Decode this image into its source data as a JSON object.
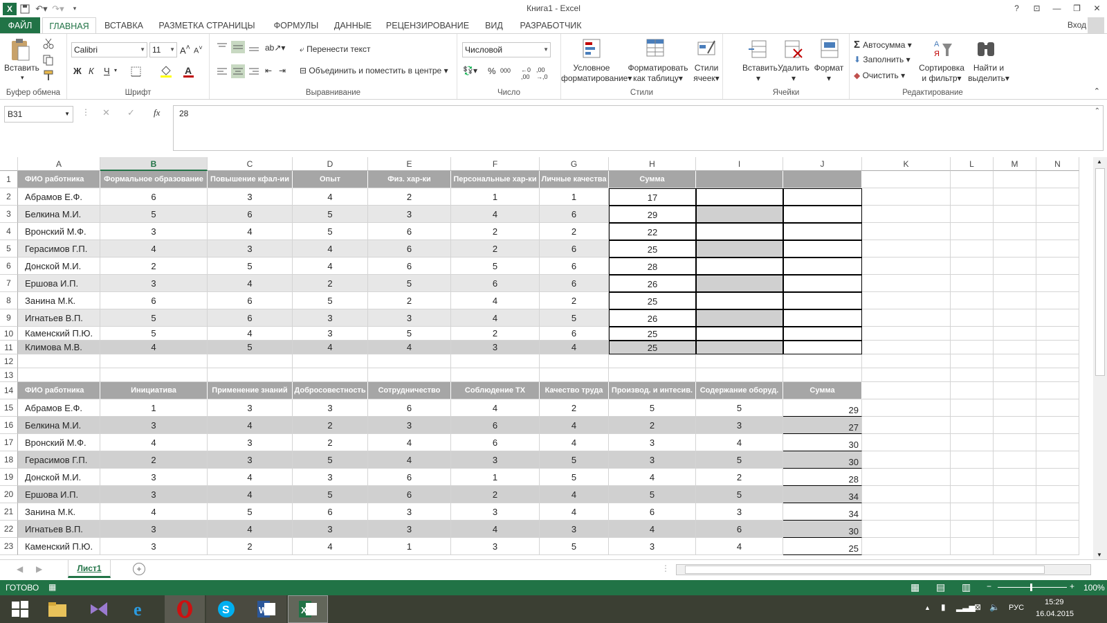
{
  "app": {
    "title": "Книга1 - Excel",
    "file_tab": "ФАЙЛ",
    "tabs": [
      "ГЛАВНАЯ",
      "ВСТАВКА",
      "РАЗМЕТКА СТРАНИЦЫ",
      "ФОРМУЛЫ",
      "ДАННЫЕ",
      "РЕЦЕНЗИРОВАНИЕ",
      "ВИД",
      "РАЗРАБОТЧИК"
    ],
    "login": "Вход",
    "help": "?"
  },
  "ribbon": {
    "clipboard": {
      "paste": "Вставить",
      "label": "Буфер обмена"
    },
    "font": {
      "name": "Calibri",
      "size": "11",
      "bold": "Ж",
      "italic": "К",
      "underline": "Ч",
      "label": "Шрифт"
    },
    "alignment": {
      "wrap": "Перенести текст",
      "merge": "Объединить и поместить в центре",
      "label": "Выравнивание"
    },
    "number": {
      "format": "Числовой",
      "label": "Число"
    },
    "styles": {
      "conditional1": "Условное",
      "conditional2": "форматирование",
      "astable1": "Форматировать",
      "astable2": "как таблицу",
      "cellstyles1": "Стили",
      "cellstyles2": "ячеек",
      "label": "Стили"
    },
    "cells": {
      "insert": "Вставить",
      "delete": "Удалить",
      "format": "Формат",
      "label": "Ячейки"
    },
    "editing": {
      "autosum": "Автосумма",
      "fill": "Заполнить",
      "clear": "Очистить",
      "sort1": "Сортировка",
      "sort2": "и фильтр",
      "find1": "Найти и",
      "find2": "выделить",
      "label": "Редактирование"
    }
  },
  "formula_bar": {
    "name_box": "B31",
    "fx": "fx",
    "value": "28"
  },
  "columns": [
    "A",
    "B",
    "C",
    "D",
    "E",
    "F",
    "G",
    "H",
    "I",
    "J",
    "K",
    "L",
    "M",
    "N"
  ],
  "selected_column": "B",
  "rows": [
    "1",
    "2",
    "3",
    "4",
    "5",
    "6",
    "7",
    "8",
    "9",
    "10",
    "11",
    "12",
    "13",
    "14",
    "15",
    "16",
    "17",
    "18",
    "19",
    "20",
    "21",
    "22",
    "23"
  ],
  "table1": {
    "headers": [
      "ФИО работника",
      "Формальное образование",
      "Повышение кфал-ии",
      "Опыт",
      "Физ. хар-ки",
      "Персональные хар-ки",
      "Личные качества",
      "Сумма"
    ],
    "rows": [
      [
        "Абрамов Е.Ф.",
        "6",
        "3",
        "4",
        "2",
        "1",
        "1",
        "17"
      ],
      [
        "Белкина М.И.",
        "5",
        "6",
        "5",
        "3",
        "4",
        "6",
        "29"
      ],
      [
        "Вронский М.Ф.",
        "3",
        "4",
        "5",
        "6",
        "2",
        "2",
        "22"
      ],
      [
        "Герасимов Г.П.",
        "4",
        "3",
        "4",
        "6",
        "2",
        "6",
        "25"
      ],
      [
        "Донской М.И.",
        "2",
        "5",
        "4",
        "6",
        "5",
        "6",
        "28"
      ],
      [
        "Ершова И.П.",
        "3",
        "4",
        "2",
        "5",
        "6",
        "6",
        "26"
      ],
      [
        "Занина М.К.",
        "6",
        "6",
        "5",
        "2",
        "4",
        "2",
        "25"
      ],
      [
        "Игнатьев В.П.",
        "5",
        "6",
        "3",
        "3",
        "4",
        "5",
        "26"
      ],
      [
        "Каменский П.Ю.",
        "5",
        "4",
        "3",
        "5",
        "2",
        "6",
        "25"
      ],
      [
        "Климова М.В.",
        "4",
        "5",
        "4",
        "4",
        "3",
        "4",
        "25"
      ]
    ]
  },
  "table2": {
    "headers": [
      "ФИО работника",
      "Инициатива",
      "Применение знаний",
      "Добросовестность",
      "Сотрудничество",
      "Соблюдение ТХ",
      "Качество труда",
      "Производ. и интесив.",
      "Содержание оборуд.",
      "Сумма"
    ],
    "rows": [
      [
        "Абрамов Е.Ф.",
        "1",
        "3",
        "3",
        "6",
        "4",
        "2",
        "5",
        "5",
        "29"
      ],
      [
        "Белкина М.И.",
        "3",
        "4",
        "2",
        "3",
        "6",
        "4",
        "2",
        "3",
        "27"
      ],
      [
        "Вронский М.Ф.",
        "4",
        "3",
        "2",
        "4",
        "6",
        "4",
        "3",
        "4",
        "30"
      ],
      [
        "Герасимов Г.П.",
        "2",
        "3",
        "5",
        "4",
        "3",
        "5",
        "3",
        "5",
        "30"
      ],
      [
        "Донской М.И.",
        "3",
        "4",
        "3",
        "6",
        "1",
        "5",
        "4",
        "2",
        "28"
      ],
      [
        "Ершова И.П.",
        "3",
        "4",
        "5",
        "6",
        "2",
        "4",
        "5",
        "5",
        "34"
      ],
      [
        "Занина М.К.",
        "4",
        "5",
        "6",
        "3",
        "3",
        "4",
        "6",
        "3",
        "34"
      ],
      [
        "Игнатьев В.П.",
        "3",
        "4",
        "3",
        "3",
        "4",
        "3",
        "4",
        "6",
        "30"
      ],
      [
        "Каменский П.Ю.",
        "3",
        "2",
        "4",
        "1",
        "3",
        "5",
        "3",
        "4",
        "25"
      ]
    ]
  },
  "sheet": {
    "tab": "Лист1"
  },
  "status": {
    "ready": "ГОТОВО",
    "zoom": "100%"
  },
  "taskbar": {
    "lang": "РУС",
    "time": "15:29",
    "date": "16.04.2015"
  },
  "colors": {
    "accent": "#217346",
    "header_fill": "#a6a6a6"
  }
}
